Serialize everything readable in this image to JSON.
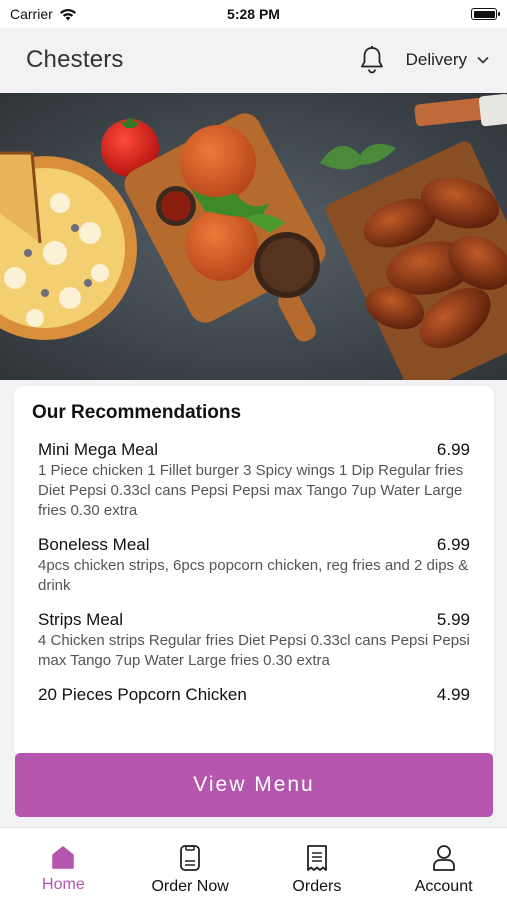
{
  "status_bar": {
    "carrier": "Carrier",
    "time": "5:28 PM"
  },
  "header": {
    "title": "Chesters",
    "delivery_mode": "Delivery"
  },
  "recommendations": {
    "title": "Our Recommendations",
    "items": [
      {
        "name": "Mini Mega Meal",
        "price": "6.99",
        "description": "1 Piece chicken  1 Fillet burger  3 Spicy wings  1 Dip  Regular fries  Diet Pepsi  0.33cl cans Pepsi  Pepsi max  Tango  7up  Water   Large fries 0.30 extra"
      },
      {
        "name": "Boneless Meal",
        "price": "6.99",
        "description": "4pcs chicken strips, 6pcs popcorn chicken, reg fries and 2 dips & drink"
      },
      {
        "name": "Strips Meal",
        "price": "5.99",
        "description": "4 Chicken strips  Regular fries  Diet Pepsi  0.33cl cans Pepsi  Pepsi max  Tango  7up  Water   Large fries 0.30 extra"
      },
      {
        "name": "20 Pieces Popcorn Chicken",
        "price": "4.99",
        "description": ""
      }
    ]
  },
  "view_menu_label": "View Menu",
  "tabs": [
    {
      "label": "Home",
      "icon": "home-icon",
      "active": true
    },
    {
      "label": "Order Now",
      "icon": "order-icon",
      "active": false
    },
    {
      "label": "Orders",
      "icon": "receipt-icon",
      "active": false
    },
    {
      "label": "Account",
      "icon": "person-icon",
      "active": false
    }
  ],
  "colors": {
    "accent": "#b456ae",
    "background": "#f2f2f4"
  }
}
